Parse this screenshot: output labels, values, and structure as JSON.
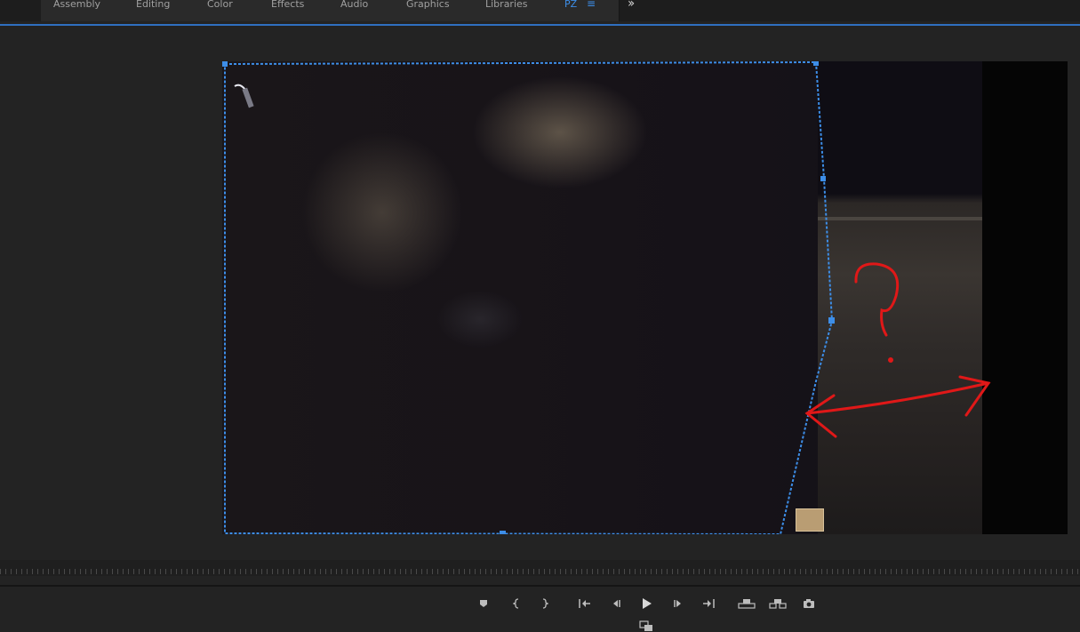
{
  "workspaces": {
    "tabs": [
      {
        "label": "Assembly"
      },
      {
        "label": "Editing"
      },
      {
        "label": "Color"
      },
      {
        "label": "Effects"
      },
      {
        "label": "Audio"
      },
      {
        "label": "Graphics"
      },
      {
        "label": "Libraries"
      },
      {
        "label": "PZ",
        "active": true
      }
    ],
    "menu_icon": "hamburger-menu-icon",
    "overflow_icon": "double-chevron-right-icon"
  },
  "monitor": {
    "annotation": {
      "text": "?",
      "color": "#e01818",
      "arrow": "double-arrow"
    },
    "selection_color": "#3d8ee8"
  },
  "transport": {
    "buttons": [
      {
        "name": "add-marker-button",
        "icon": "marker-icon"
      },
      {
        "name": "mark-in-button",
        "icon": "mark-in-icon"
      },
      {
        "name": "mark-out-button",
        "icon": "mark-out-icon"
      },
      {
        "name": "go-to-in-button",
        "icon": "go-to-in-icon"
      },
      {
        "name": "step-back-button",
        "icon": "step-back-icon"
      },
      {
        "name": "play-button",
        "icon": "play-icon"
      },
      {
        "name": "step-forward-button",
        "icon": "step-forward-icon"
      },
      {
        "name": "go-to-out-button",
        "icon": "go-to-out-icon"
      },
      {
        "name": "lift-button",
        "icon": "lift-icon"
      },
      {
        "name": "extract-button",
        "icon": "extract-icon"
      },
      {
        "name": "export-frame-button",
        "icon": "camera-icon"
      }
    ]
  }
}
